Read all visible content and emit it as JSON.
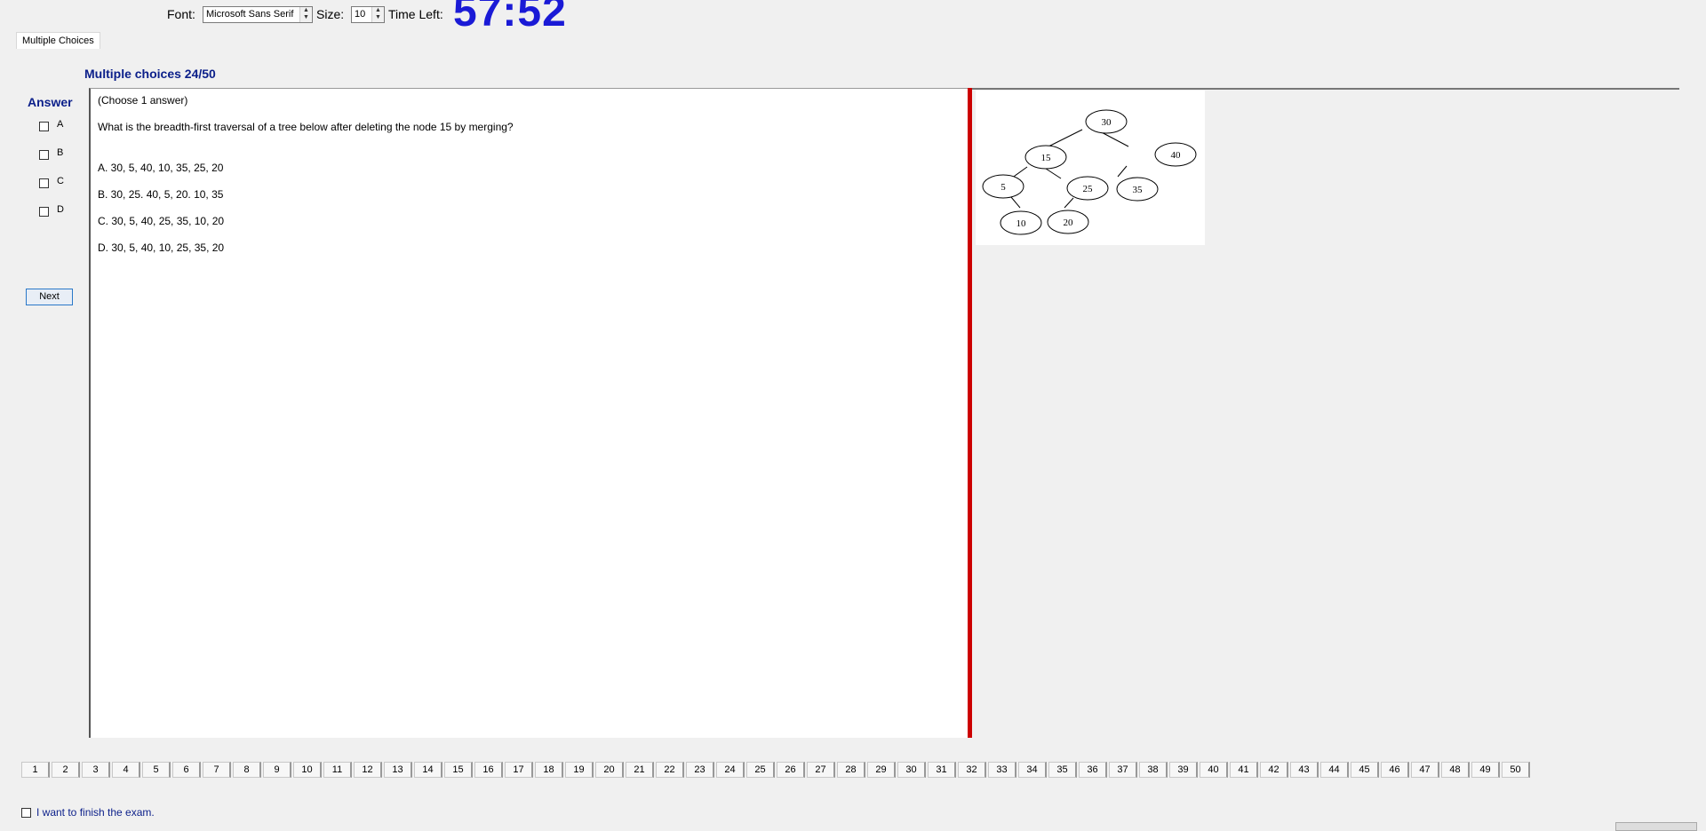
{
  "toolbar": {
    "font_label": "Font:",
    "font_value": "Microsoft Sans Serif",
    "size_label": "Size:",
    "size_value": "10",
    "time_label": "Time Left:",
    "time_value": "57:52"
  },
  "tab": {
    "label": "Multiple Choices"
  },
  "section": {
    "title": "Multiple choices 24/50"
  },
  "answer": {
    "title": "Answer",
    "options": [
      "A",
      "B",
      "C",
      "D"
    ],
    "next_label": "Next"
  },
  "question": {
    "instruction": "(Choose 1 answer)",
    "prompt": "What is the breadth-first traversal of a tree below after deleting the node  15  by merging?",
    "choices": [
      "A.  30, 5, 40, 10, 35, 25, 20",
      "B.  30, 25. 40, 5, 20. 10, 35",
      "C.  30, 5, 40, 25, 35, 10, 20",
      "D.  30, 5, 40, 10, 25, 35, 20"
    ]
  },
  "tree": {
    "nodes": [
      "30",
      "15",
      "40",
      "5",
      "25",
      "35",
      "10",
      "20"
    ]
  },
  "pager": {
    "pages": [
      "1",
      "2",
      "3",
      "4",
      "5",
      "6",
      "7",
      "8",
      "9",
      "10",
      "11",
      "12",
      "13",
      "14",
      "15",
      "16",
      "17",
      "18",
      "19",
      "20",
      "21",
      "22",
      "23",
      "24",
      "25",
      "26",
      "27",
      "28",
      "29",
      "30",
      "31",
      "32",
      "33",
      "34",
      "35",
      "36",
      "37",
      "38",
      "39",
      "40",
      "41",
      "42",
      "43",
      "44",
      "45",
      "46",
      "47",
      "48",
      "49",
      "50"
    ]
  },
  "finish": {
    "label": "I want to finish the exam."
  },
  "colors": {
    "timer": "#1a1ad6",
    "heading": "#0b1f8a",
    "divider": "#cc0000"
  }
}
